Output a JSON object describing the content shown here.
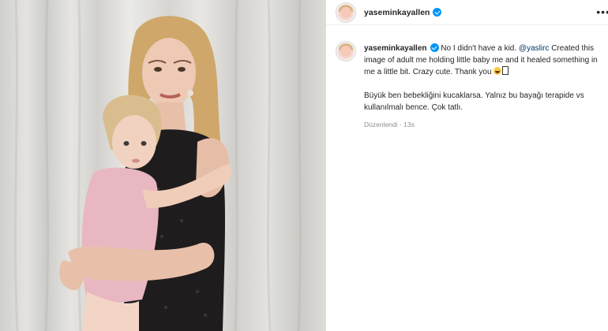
{
  "post": {
    "username": "yaseminkayallen",
    "menu_icon": "more-horizontal-icon",
    "caption": {
      "username": "yaseminkayallen",
      "text_before_mention": "No I didn't have a kid.",
      "mention": "@yaslirc",
      "text_after_mention": "Created this image of adult me holding little baby me and it healed something in me a little bit. Crazy cute. Thank you",
      "emoji_icon": "laughing-emoji-icon",
      "paragraph2": "Büyük ben bebekliğini kucaklarsa. Yalnız bu bayağı terapide vs kullanılmalı bence. Çok tatlı.",
      "edited_label": "Düzenlendi",
      "separator": "·",
      "time_ago": "13s"
    }
  },
  "colors": {
    "verified_badge": "#0095f6",
    "mention_link": "#00376b",
    "secondary_text": "#8e8e8e"
  }
}
